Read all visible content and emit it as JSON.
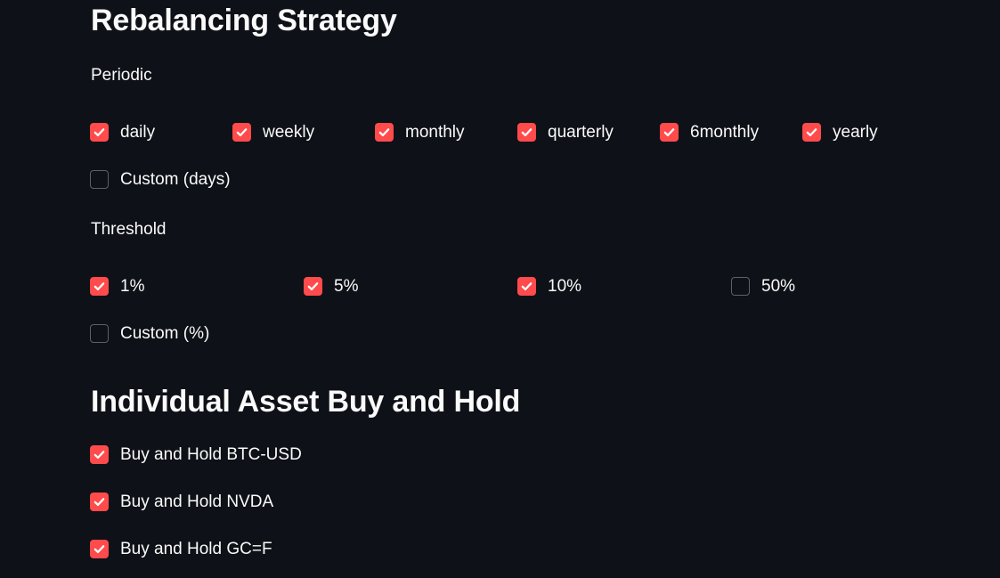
{
  "rebalancing": {
    "title": "Rebalancing Strategy",
    "periodic": {
      "label": "Periodic",
      "options": [
        {
          "label": "daily",
          "checked": true
        },
        {
          "label": "weekly",
          "checked": true
        },
        {
          "label": "monthly",
          "checked": true
        },
        {
          "label": "quarterly",
          "checked": true
        },
        {
          "label": "6monthly",
          "checked": true
        },
        {
          "label": "yearly",
          "checked": true
        }
      ],
      "custom": {
        "label": "Custom (days)",
        "checked": false
      }
    },
    "threshold": {
      "label": "Threshold",
      "options": [
        {
          "label": "1%",
          "checked": true
        },
        {
          "label": "5%",
          "checked": true
        },
        {
          "label": "10%",
          "checked": true
        },
        {
          "label": "50%",
          "checked": false
        }
      ],
      "custom": {
        "label": "Custom (%)",
        "checked": false
      }
    }
  },
  "buy_and_hold": {
    "title": "Individual Asset Buy and Hold",
    "options": [
      {
        "label": "Buy and Hold BTC-USD",
        "checked": true
      },
      {
        "label": "Buy and Hold NVDA",
        "checked": true
      },
      {
        "label": "Buy and Hold GC=F",
        "checked": true
      }
    ]
  },
  "colors": {
    "background": "#0e1117",
    "accent": "#ff4b4b",
    "text": "#fafafa",
    "unchecked_border": "#5d6069"
  },
  "icons": {
    "checkmark": "check-icon"
  }
}
